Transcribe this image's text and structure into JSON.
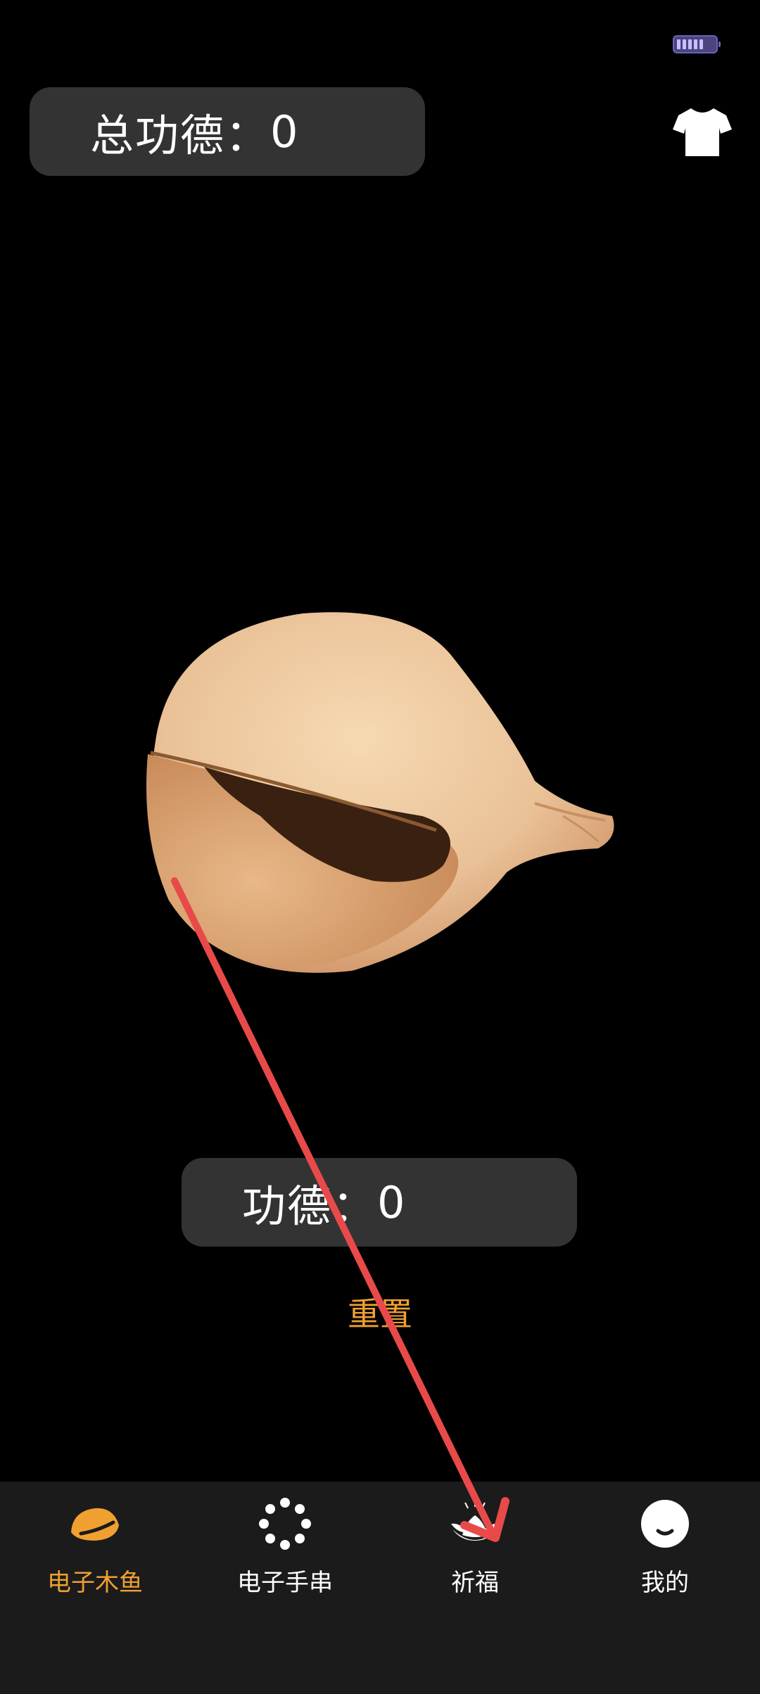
{
  "header": {
    "total_merit_label": "总功德：",
    "total_merit_value": "0"
  },
  "counter": {
    "merit_label": "功德：",
    "merit_value": "0",
    "reset_label": "重置"
  },
  "tabbar": {
    "tabs": [
      {
        "label": "电子木鱼",
        "icon": "wooden-fish-icon",
        "active": true
      },
      {
        "label": "电子手串",
        "icon": "bead-bracelet-icon",
        "active": false
      },
      {
        "label": "祈福",
        "icon": "lotus-icon",
        "active": false
      },
      {
        "label": "我的",
        "icon": "profile-icon",
        "active": false
      }
    ]
  },
  "colors": {
    "accent": "#f0a030",
    "pill_bg": "#333333",
    "tabbar_bg": "#1b1b1b",
    "annotation_arrow": "#e84a4a"
  }
}
